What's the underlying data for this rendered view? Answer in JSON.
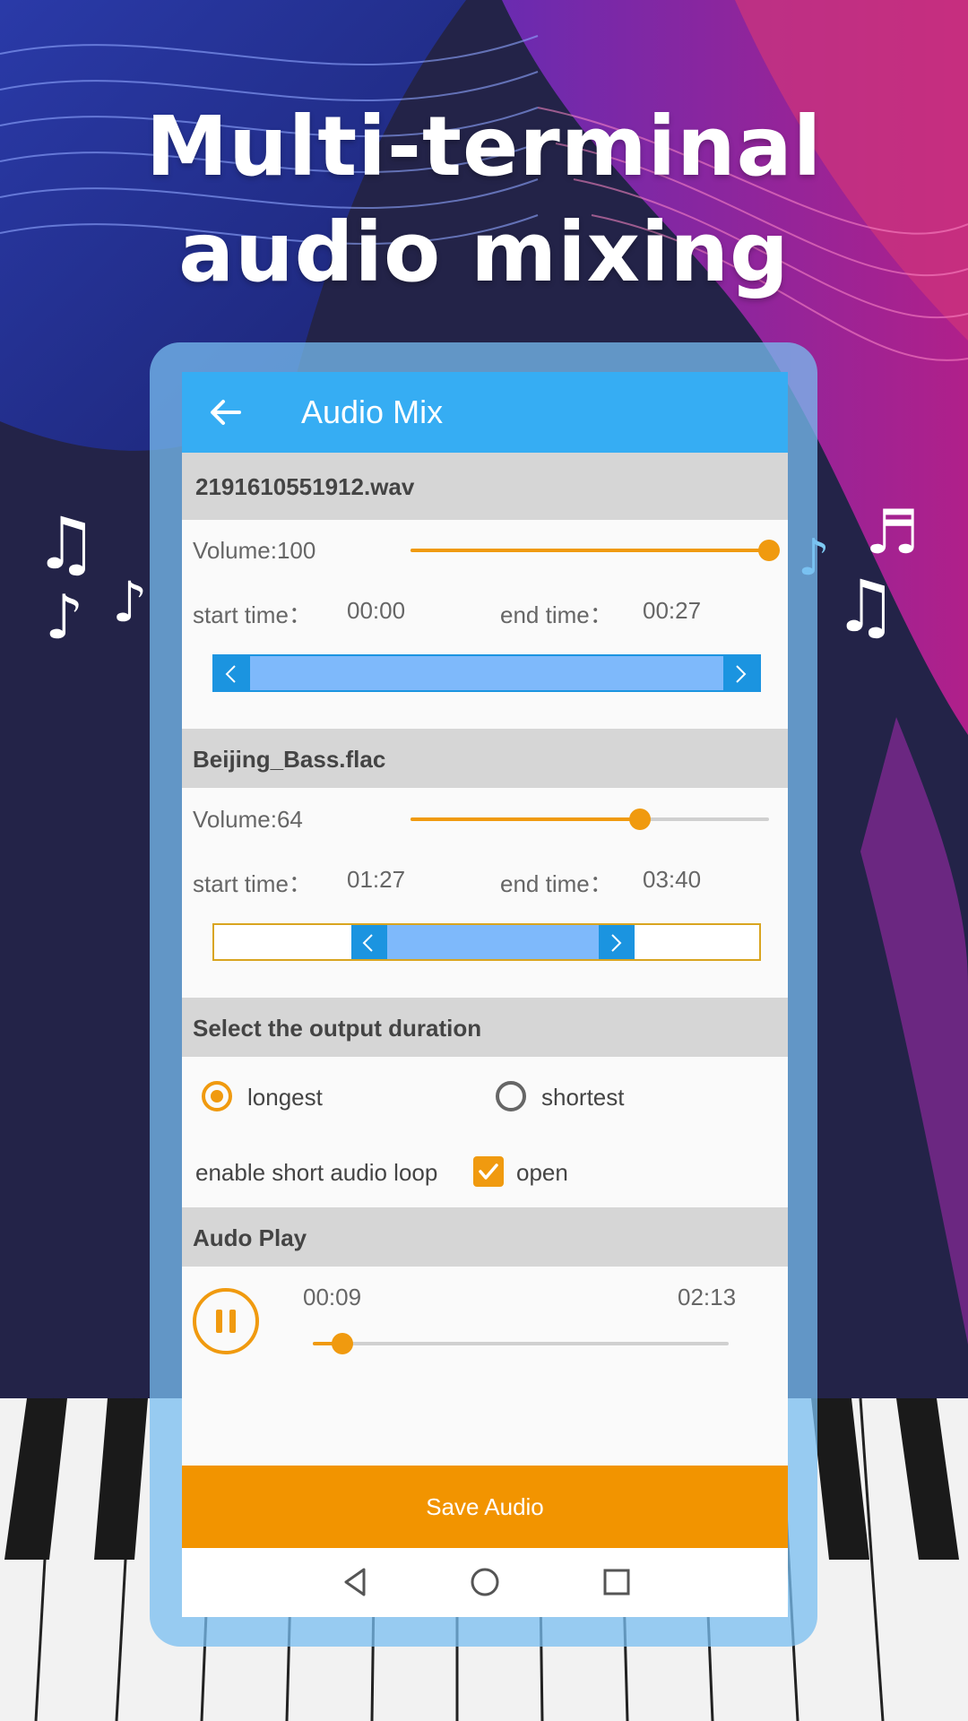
{
  "headline": {
    "line1": "Multi-terminal",
    "line2": "audio mixing"
  },
  "appbar": {
    "title": "Audio Mix",
    "back_icon": "arrow-left-icon"
  },
  "tracks": [
    {
      "file_name": "2191610551912.wav",
      "volume_label": "Volume:100",
      "volume_value": 100,
      "start_label": "start time：",
      "start_time": "00:00",
      "end_label": "end time：",
      "end_time": "00:27"
    },
    {
      "file_name": "Beijing_Bass.flac",
      "volume_label": "Volume:64",
      "volume_value": 64,
      "start_label": "start time：",
      "start_time": "01:27",
      "end_label": "end time：",
      "end_time": "03:40"
    }
  ],
  "output": {
    "header": "Select the output duration",
    "options": [
      "longest",
      "shortest"
    ],
    "selected": "longest",
    "loop_label": "enable short audio loop",
    "loop_checkbox_label": "open",
    "loop_checked": true
  },
  "player": {
    "header": "Audo Play",
    "current_time": "00:09",
    "total_time": "02:13",
    "state": "playing",
    "button_icon": "pause-icon"
  },
  "save_button": "Save Audio",
  "nav_icons": [
    "back-triangle-icon",
    "home-circle-icon",
    "recents-square-icon"
  ],
  "colors": {
    "accent": "#f29400",
    "appbar": "#36adf3",
    "range_selection": "#7eb9fb",
    "range_handle": "#1b94e0",
    "background": "#232348"
  }
}
